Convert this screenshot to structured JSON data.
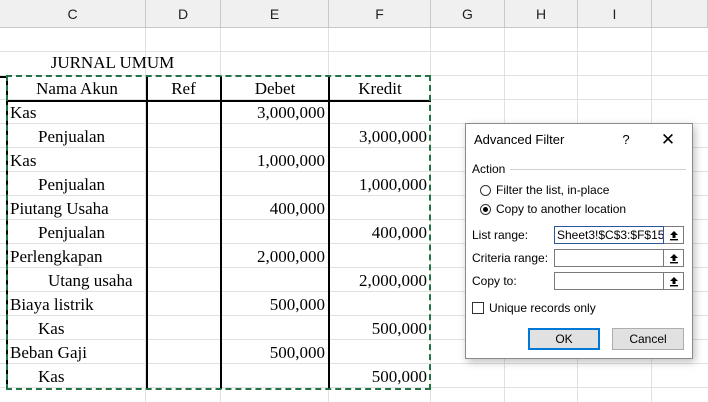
{
  "columns": [
    "C",
    "D",
    "E",
    "F",
    "G",
    "H",
    "I"
  ],
  "sheet": {
    "title": "JURNAL UMUM",
    "headers": [
      "Nama Akun",
      "Ref",
      "Debet",
      "Kredit"
    ],
    "rows": [
      {
        "akun": "Kas",
        "ref": "",
        "debet": "3,000,000",
        "kredit": ""
      },
      {
        "akun": "Penjualan",
        "ref": "",
        "debet": "",
        "kredit": "3,000,000"
      },
      {
        "akun": "Kas",
        "ref": "",
        "debet": "1,000,000",
        "kredit": ""
      },
      {
        "akun": "Penjualan",
        "ref": "",
        "debet": "",
        "kredit": "1,000,000"
      },
      {
        "akun": "Piutang Usaha",
        "ref": "",
        "debet": "400,000",
        "kredit": ""
      },
      {
        "akun": "Penjualan",
        "ref": "",
        "debet": "",
        "kredit": "400,000"
      },
      {
        "akun": "Perlengkapan",
        "ref": "",
        "debet": "2,000,000",
        "kredit": ""
      },
      {
        "akun": "Utang usaha",
        "ref": "",
        "debet": "",
        "kredit": "2,000,000"
      },
      {
        "akun": "Biaya listrik",
        "ref": "",
        "debet": "500,000",
        "kredit": ""
      },
      {
        "akun": "Kas",
        "ref": "",
        "debet": "",
        "kredit": "500,000"
      },
      {
        "akun": "Beban Gaji",
        "ref": "",
        "debet": "500,000",
        "kredit": ""
      },
      {
        "akun": "Kas",
        "ref": "",
        "debet": "",
        "kredit": "500,000"
      }
    ]
  },
  "dialog": {
    "title": "Advanced Filter",
    "help": "?",
    "close": "✕",
    "action_label": "Action",
    "radio_filter": "Filter the list, in-place",
    "radio_copy": "Copy to another location",
    "list_range_label": "List range:",
    "list_range_value": "Sheet3!$C$3:$F$15",
    "criteria_label": "Criteria range:",
    "criteria_value": "",
    "copyto_label": "Copy to:",
    "copyto_value": "",
    "unique_label": "Unique records only",
    "ok": "OK",
    "cancel": "Cancel"
  },
  "icons": {
    "range_button": "collapse-dialog-icon",
    "close": "close-icon"
  },
  "colors": {
    "selection": "#217346",
    "default_button": "#0078d7"
  }
}
